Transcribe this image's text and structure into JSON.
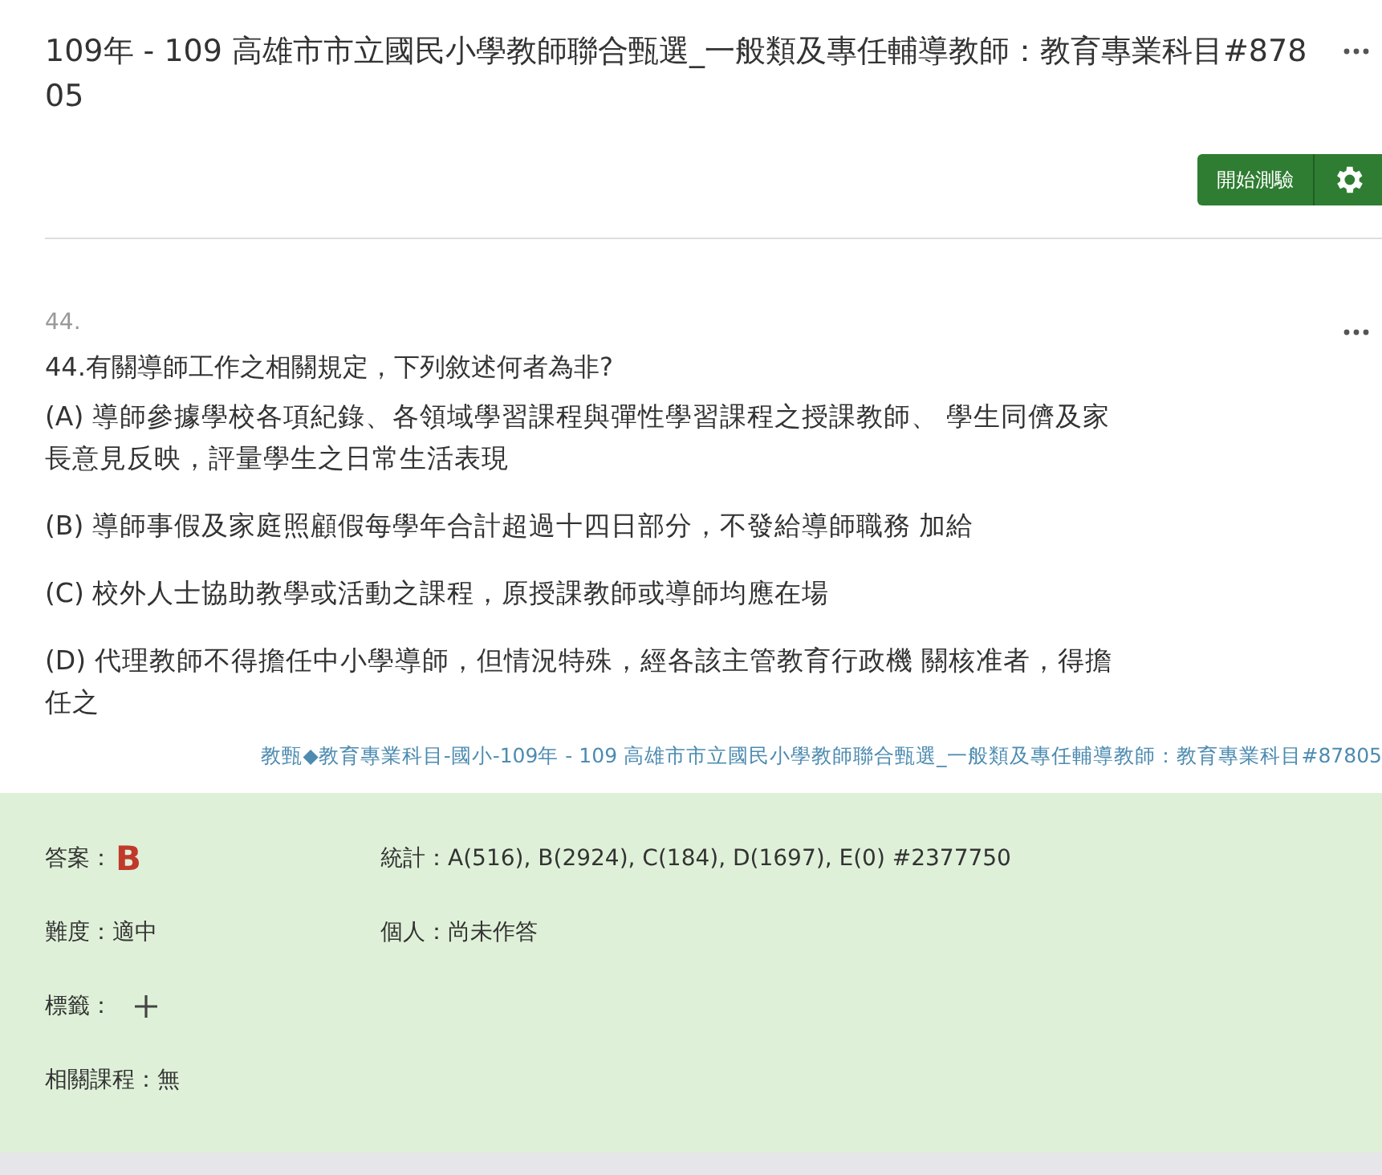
{
  "header": {
    "title": "109年 - 109 高雄市市立國民小學教師聯合甄選_一般類及專任輔導教師：教育專業科目#87805",
    "start_button": "開始測驗"
  },
  "question": {
    "number": "44.",
    "text": "44.有關導師工作之相關規定，下列敘述何者為非?",
    "options": [
      "(A) 導師參據學校各項紀錄、各領域學習課程與彈性學習課程之授課教師、 學生同儕及家長意見反映，評量學生之日常生活表現",
      "(B) 導師事假及家庭照顧假每學年合計超過十四日部分，不發給導師職務 加給",
      "(C) 校外人士協助教學或活動之課程，原授課教師或導師均應在場",
      "(D) 代理教師不得擔任中小學導師，但情況特殊，經各該主管教育行政機 關核准者，得擔任之"
    ],
    "source": "教甄◆教育專業科目-國小-109年 - 109 高雄市市立國民小學教師聯合甄選_一般類及專任輔導教師：教育專業科目#87805"
  },
  "answer_panel": {
    "answer_label": "答案：",
    "answer": "B",
    "stats": "統計：A(516), B(2924), C(184), D(1697), E(0) #2377750",
    "difficulty": "難度：適中",
    "personal": "個人：尚未作答",
    "tags_label": "標籤：",
    "courses": "相關課程：無"
  }
}
